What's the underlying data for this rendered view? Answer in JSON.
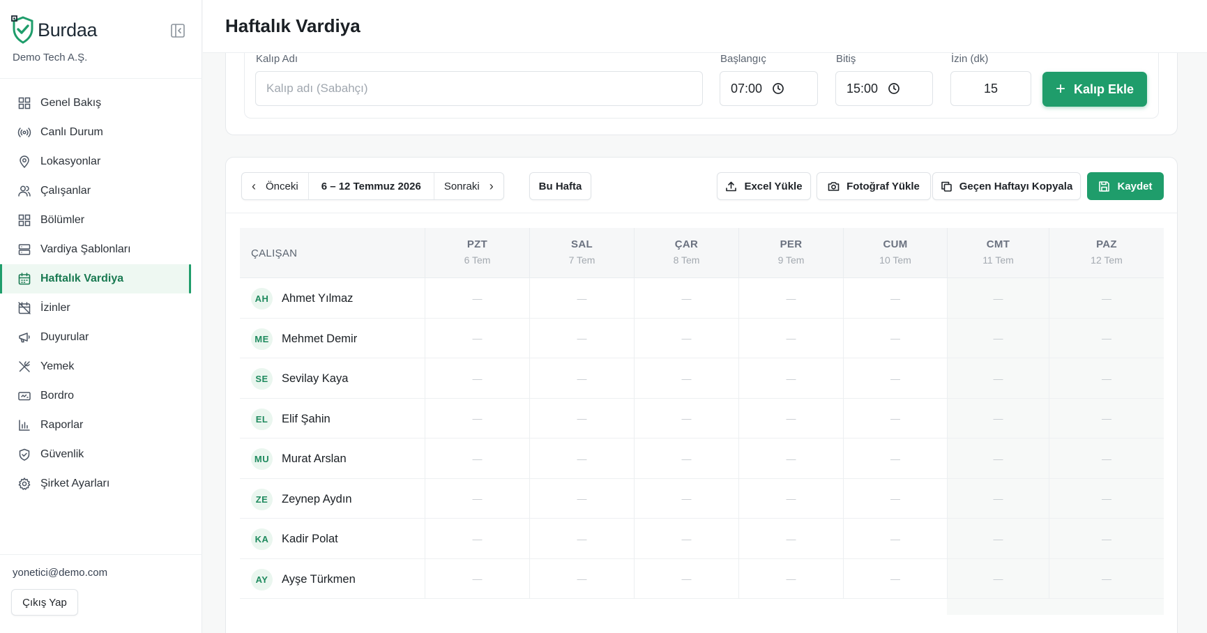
{
  "sidebar": {
    "brand_name": "Burdaa",
    "company": "Demo Tech A.Ş.",
    "items": [
      {
        "label": "Genel Bakış",
        "icon": "grid-icon"
      },
      {
        "label": "Canlı Durum",
        "icon": "broadcast-icon"
      },
      {
        "label": "Lokasyonlar",
        "icon": "map-pin-icon"
      },
      {
        "label": "Çalışanlar",
        "icon": "users-icon"
      },
      {
        "label": "Bölümler",
        "icon": "grid-icon"
      },
      {
        "label": "Vardiya Şablonları",
        "icon": "server-icon"
      },
      {
        "label": "Haftalık Vardiya",
        "icon": "calendar-icon",
        "active": true
      },
      {
        "label": "İzinler",
        "icon": "calendar-off-icon"
      },
      {
        "label": "Duyurular",
        "icon": "megaphone-icon"
      },
      {
        "label": "Yemek",
        "icon": "utensils-icon"
      },
      {
        "label": "Bordro",
        "icon": "banknote-icon"
      },
      {
        "label": "Raporlar",
        "icon": "bar-chart-icon"
      },
      {
        "label": "Güvenlik",
        "icon": "shield-icon"
      },
      {
        "label": "Şirket Ayarları",
        "icon": "gear-icon"
      }
    ],
    "user_email": "yonetici@demo.com",
    "logout_label": "Çıkış Yap"
  },
  "header": {
    "title": "Haftalık Vardiya"
  },
  "template_form": {
    "name_label": "Kalıp Adı",
    "name_placeholder": "Kalıp adı (Sabahçı)",
    "start_label": "Başlangıç",
    "start_value": "07:00",
    "end_label": "Bitiş",
    "end_value": "15:00",
    "break_label": "İzin (dk)",
    "break_value": "15",
    "add_label": "Kalıp Ekle"
  },
  "toolbar": {
    "prev_label": "Önceki",
    "range_label": "6 – 12 Temmuz 2026",
    "next_label": "Sonraki",
    "this_week_label": "Bu Hafta",
    "excel_label": "Excel Yükle",
    "photo_label": "Fotoğraf Yükle",
    "copy_label": "Geçen Haftayı Kopyala",
    "save_label": "Kaydet"
  },
  "schedule": {
    "employee_header": "ÇALIŞAN",
    "days": [
      {
        "name": "PZT",
        "date": "6 Tem"
      },
      {
        "name": "SAL",
        "date": "7 Tem"
      },
      {
        "name": "ÇAR",
        "date": "8 Tem"
      },
      {
        "name": "PER",
        "date": "9 Tem"
      },
      {
        "name": "CUM",
        "date": "10 Tem"
      },
      {
        "name": "CMT",
        "date": "11 Tem"
      },
      {
        "name": "PAZ",
        "date": "12 Tem"
      }
    ],
    "empty_cell": "—",
    "employees": [
      {
        "initials": "AH",
        "name": "Ahmet Yılmaz"
      },
      {
        "initials": "ME",
        "name": "Mehmet Demir"
      },
      {
        "initials": "SE",
        "name": "Sevilay Kaya"
      },
      {
        "initials": "EL",
        "name": "Elif Şahin"
      },
      {
        "initials": "MU",
        "name": "Murat Arslan"
      },
      {
        "initials": "ZE",
        "name": "Zeynep Aydın"
      },
      {
        "initials": "KA",
        "name": "Kadir Polat"
      },
      {
        "initials": "AY",
        "name": "Ayşe Türkmen"
      }
    ]
  },
  "colors": {
    "accent": "#1f9d6b",
    "accent_light": "#eaf6ef"
  }
}
